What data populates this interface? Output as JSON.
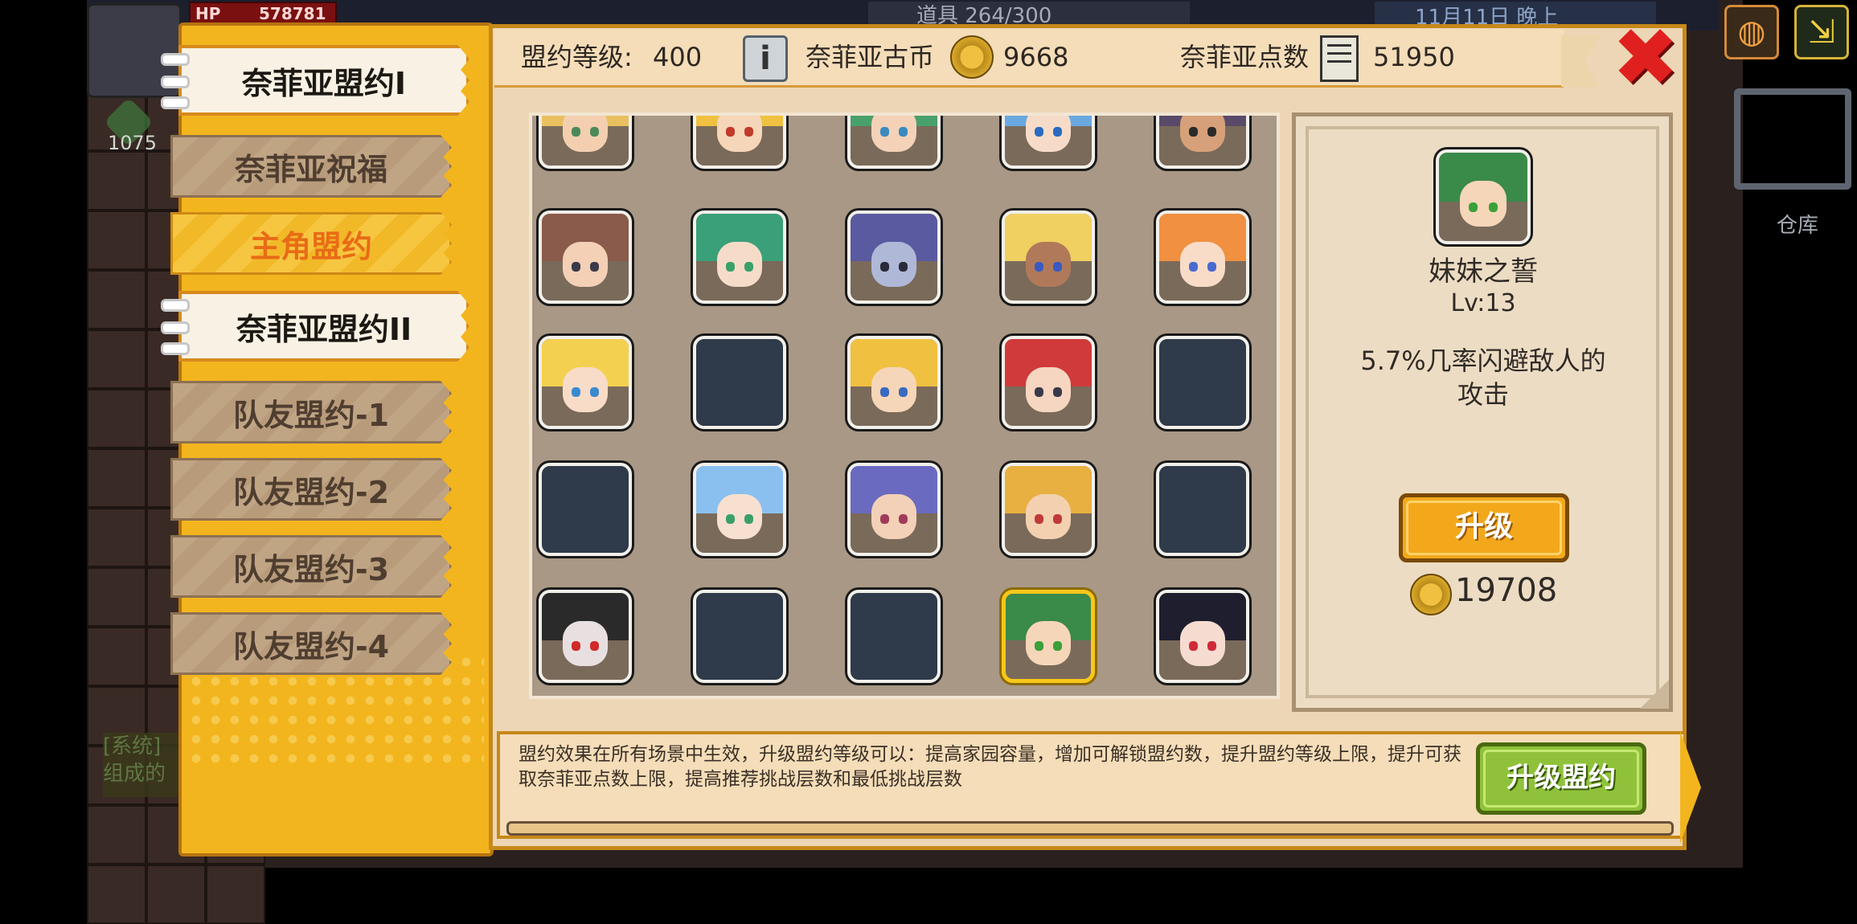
{
  "hud": {
    "hp_label": "HP",
    "hp_value": "578781",
    "gem_count": "1075",
    "items_text": "道具 264/300",
    "time_text": "11月11日 晚上",
    "warehouse_label": "仓库",
    "system_msg": "[系统]\n组成的"
  },
  "tabs": [
    {
      "label": "奈菲亚盟约I",
      "state": "active"
    },
    {
      "label": "奈菲亚祝福",
      "state": "normal"
    },
    {
      "label": "主角盟约",
      "state": "highlight"
    },
    {
      "label": "奈菲亚盟约II",
      "state": "active"
    },
    {
      "label": "队友盟约-1",
      "state": "normal"
    },
    {
      "label": "队友盟约-2",
      "state": "normal"
    },
    {
      "label": "队友盟约-3",
      "state": "normal"
    },
    {
      "label": "队友盟约-4",
      "state": "normal"
    }
  ],
  "header": {
    "level_label": "盟约等级:",
    "level_value": "400",
    "coin_label": "奈菲亚古币",
    "coin_value": "9668",
    "points_label": "奈菲亚点数",
    "points_value": "51950"
  },
  "grid": {
    "rows": [
      [
        {
          "hair": "#e8c060",
          "skin": "#f3cfb0",
          "eye": "#4a8a5a"
        },
        {
          "hair": "#f0c040",
          "skin": "#f6d6b8",
          "eye": "#c23a2a"
        },
        {
          "hair": "#4aa06a",
          "skin": "#f3d2b8",
          "eye": "#3a8ac0"
        },
        {
          "hair": "#6aa8e0",
          "skin": "#f6dcc8",
          "eye": "#2a6ac0"
        },
        {
          "hair": "#5a4a6a",
          "skin": "#d6a07a",
          "eye": "#2a2a2a"
        }
      ],
      [
        {
          "hair": "#8a5a4a",
          "skin": "#f3d0b6",
          "eye": "#3a3a4a"
        },
        {
          "hair": "#3aa07a",
          "skin": "#f6dcc8",
          "eye": "#3aa06a"
        },
        {
          "hair": "#5a5aa0",
          "skin": "#b0b8d8",
          "eye": "#2a2a3a"
        },
        {
          "hair": "#f0d060",
          "skin": "#b07a5a",
          "eye": "#3a5ac0"
        },
        {
          "hair": "#f09040",
          "skin": "#f8dcc8",
          "eye": "#4a6ad0"
        }
      ],
      [
        {
          "hair": "#f3d050",
          "skin": "#f8dcc8",
          "eye": "#3a8ad0"
        },
        null,
        {
          "hair": "#f0c040",
          "skin": "#f6d6b8",
          "eye": "#3a6ac0"
        },
        {
          "hair": "#d03a3a",
          "skin": "#f6d6c0",
          "eye": "#3a3a4a"
        },
        null
      ],
      [
        null,
        {
          "hair": "#8ac0f0",
          "skin": "#f8e0d0",
          "eye": "#3aa06a"
        },
        {
          "hair": "#6a6ac0",
          "skin": "#f3d0b8",
          "eye": "#a03a5a"
        },
        {
          "hair": "#e8b040",
          "skin": "#f3d0b0",
          "eye": "#c03a3a"
        },
        null
      ],
      [
        {
          "hair": "#2a2a2a",
          "skin": "#e8e0e0",
          "eye": "#d02a2a"
        },
        null,
        null,
        {
          "hair": "#3a8a4a",
          "skin": "#f6d6b8",
          "eye": "#3aa03a",
          "selected": true
        },
        {
          "hair": "#1e1e2e",
          "skin": "#f6dcd0",
          "eye": "#d02a3a"
        }
      ]
    ]
  },
  "detail": {
    "name": "妹妹之誓",
    "level": "Lv:13",
    "effect": "5.7%几率闪避敌人的\n攻击",
    "upgrade_label": "升级",
    "cost": "19708"
  },
  "footer": {
    "description": "盟约效果在所有场景中生效，升级盟约等级可以：提高家园容量，增加可解锁盟约数，提升盟约等级上限，提升可获取奈菲亚点数上限，提高推荐挑战层数和最低挑战层数",
    "upgrade_pact_label": "升级盟约"
  },
  "colors": {
    "panel_bg": "#ecd6b5",
    "tab_panel": "#f3b51e",
    "close_red": "#e0201e",
    "upgrade_btn": "#f3a81c",
    "pact_btn": "#8fc23a",
    "selected_border": "#f7c71a"
  },
  "icons": [
    "info-icon",
    "coin-icon",
    "points-card-icon",
    "close-icon",
    "globe-icon",
    "exit-icon",
    "warehouse-icon"
  ]
}
